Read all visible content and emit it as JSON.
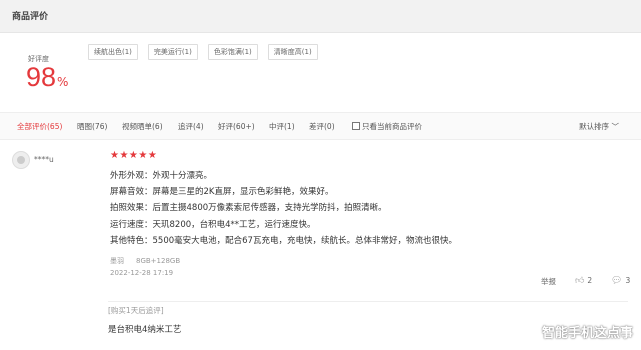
{
  "header": {
    "title": "商品评价"
  },
  "rating": {
    "label": "好评度",
    "value": "98",
    "percent": "%"
  },
  "tags": [
    "续航出色(1)",
    "完美运行(1)",
    "色彩饱满(1)",
    "清晰度高(1)"
  ],
  "filters": [
    {
      "label": "全部评价(65)",
      "active": true
    },
    {
      "label": "晒图(76)",
      "active": false
    },
    {
      "label": "视频晒单(6)",
      "active": false
    },
    {
      "label": "追评(4)",
      "active": false
    },
    {
      "label": "好评(60+)",
      "active": false
    },
    {
      "label": "中评(1)",
      "active": false
    },
    {
      "label": "差评(0)",
      "active": false
    }
  ],
  "only_current": "只看当前商品评价",
  "sort": "默认排序",
  "review": {
    "user": "****u",
    "stars": "★★★★★",
    "lines": [
      "外形外观：外观十分漂亮。",
      "屏幕音效：屏幕是三星的2K直屏，显示色彩鲜艳，效果好。",
      "拍照效果：后置主摄4800万像素索尼传感器，支持光学防抖，拍照清晰。",
      "运行速度：天玑8200，台积电4**工艺，运行速度快。",
      "其他特色：5500毫安大电池，配合67瓦充电，充电快，续航长。总体非常好，物流也很快。"
    ],
    "color": "墨羽",
    "spec": "8GB+128GB",
    "date": "2022-12-28 17:19",
    "report": "举报",
    "likes": "2",
    "comments": "3",
    "follow_label": "[购买1天后追评]",
    "follow_text": "是台积电4纳米工艺"
  },
  "watermark": "智能手机这点事",
  "colors": {
    "accent": "#e4393c"
  },
  "icons": [
    "checkbox-icon",
    "chevron-down-icon",
    "avatar-icon",
    "thumbs-up-icon",
    "comment-icon"
  ]
}
